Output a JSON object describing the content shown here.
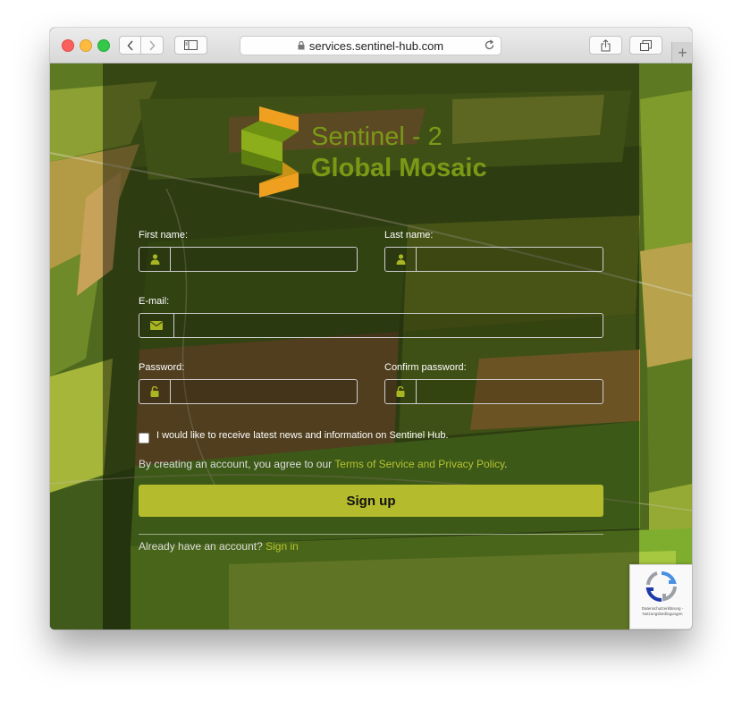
{
  "browser": {
    "url": "services.sentinel-hub.com",
    "new_tab_label": "+"
  },
  "logo": {
    "line1": "Sentinel - 2",
    "line2": "Global Mosaic"
  },
  "form": {
    "first_name_label": "First name:",
    "last_name_label": "Last name:",
    "email_label": "E-mail:",
    "password_label": "Password:",
    "confirm_password_label": "Confirm password:",
    "first_name_value": "",
    "last_name_value": "",
    "email_value": "",
    "password_value": "",
    "confirm_password_value": "",
    "newsletter_label": "I would like to receive latest news and information on Sentinel Hub.",
    "newsletter_checked": false,
    "terms_prefix": "By creating an account, you agree to our ",
    "terms_link": "Terms of Service and Privacy Policy",
    "terms_suffix": ".",
    "signup_label": "Sign up",
    "signin_prefix": "Already have an account? ",
    "signin_link": "Sign in"
  },
  "recaptcha": {
    "footer_text": "Datenschutzerklärung - Nutzungsbedingungen"
  },
  "colors": {
    "accent": "#b4bb2c",
    "link": "#b4c22e",
    "logo_green": "#7a9a16",
    "logo_orange": "#f0a020"
  },
  "icons": {
    "first_name": "user-icon",
    "last_name": "user-icon",
    "email": "envelope-icon",
    "password": "unlock-icon",
    "confirm_password": "unlock-icon"
  }
}
